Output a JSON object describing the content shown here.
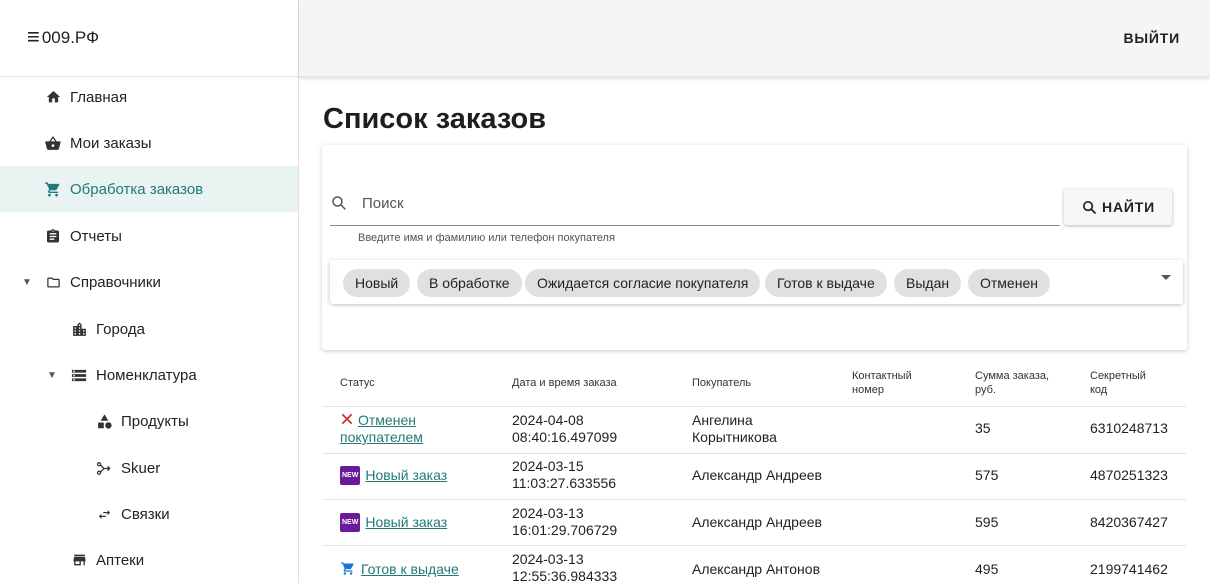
{
  "brand": {
    "menu_glyph": "≡",
    "title": "009.РФ"
  },
  "topbar": {
    "logout_label": "ВЫЙТИ"
  },
  "sidebar": {
    "items": [
      {
        "label": "Главная",
        "icon": "home-icon"
      },
      {
        "label": "Мои заказы",
        "icon": "shopping-basket-icon"
      },
      {
        "label": "Обработка заказов",
        "icon": "shopping-cart-icon",
        "active": true
      },
      {
        "label": "Отчеты",
        "icon": "assignment-icon"
      },
      {
        "label": "Справочники",
        "icon": "folder-icon",
        "expanded": true
      },
      {
        "label": "Города",
        "icon": "city-icon"
      },
      {
        "label": "Номенклатура",
        "icon": "storage-icon",
        "expanded": true
      },
      {
        "label": "Продукты",
        "icon": "category-icon"
      },
      {
        "label": "Skuer",
        "icon": "merge-icon"
      },
      {
        "label": "Связки",
        "icon": "swap-arrows-icon"
      },
      {
        "label": "Аптеки",
        "icon": "store-icon"
      }
    ]
  },
  "main": {
    "title": "Список заказов",
    "search": {
      "placeholder": "Поиск",
      "helper": "Введите имя и фамилию или телефон покупателя",
      "button_label": "НАЙТИ"
    },
    "status_filters": [
      "Новый",
      "В обработке",
      "Ожидается согласие покупателя",
      "Готов к выдаче",
      "Выдан",
      "Отменен"
    ],
    "table": {
      "headers": {
        "status": "Статус",
        "datetime": "Дата и время заказа",
        "buyer": "Покупатель",
        "phone": "Контактный номер",
        "sum": "Сумма заказа, руб.",
        "code": "Секретный код"
      },
      "rows": [
        {
          "status": "Отменен покупателем",
          "status_icon": "close-icon",
          "date": "2024-04-08",
          "time": "08:40:16.497099",
          "buyer": "Ангелина Корытникова",
          "phone": "",
          "sum": "35",
          "code": "6310248713"
        },
        {
          "status": "Новый заказ",
          "status_icon": "new-badge-icon",
          "date": "2024-03-15",
          "time": "11:03:27.633556",
          "buyer": "Александр Андреев",
          "phone": "",
          "sum": "575",
          "code": "4870251323"
        },
        {
          "status": "Новый заказ",
          "status_icon": "new-badge-icon",
          "date": "2024-03-13",
          "time": "16:01:29.706729",
          "buyer": "Александр Андреев",
          "phone": "",
          "sum": "595",
          "code": "8420367427"
        },
        {
          "status": "Готов к выдаче",
          "status_icon": "shopping-cart-icon",
          "date": "2024-03-13",
          "time": "12:55:36.984333",
          "buyer": "Александр Антонов",
          "phone": "",
          "sum": "495",
          "code": "2199741462"
        }
      ]
    },
    "badge_text": "NEW"
  },
  "colors": {
    "accent": "#1f7a78",
    "active_bg": "#e9f3f2",
    "cancel": "#d32f2f",
    "new_badge": "#6a1b9a",
    "cart": "#1976d2"
  }
}
